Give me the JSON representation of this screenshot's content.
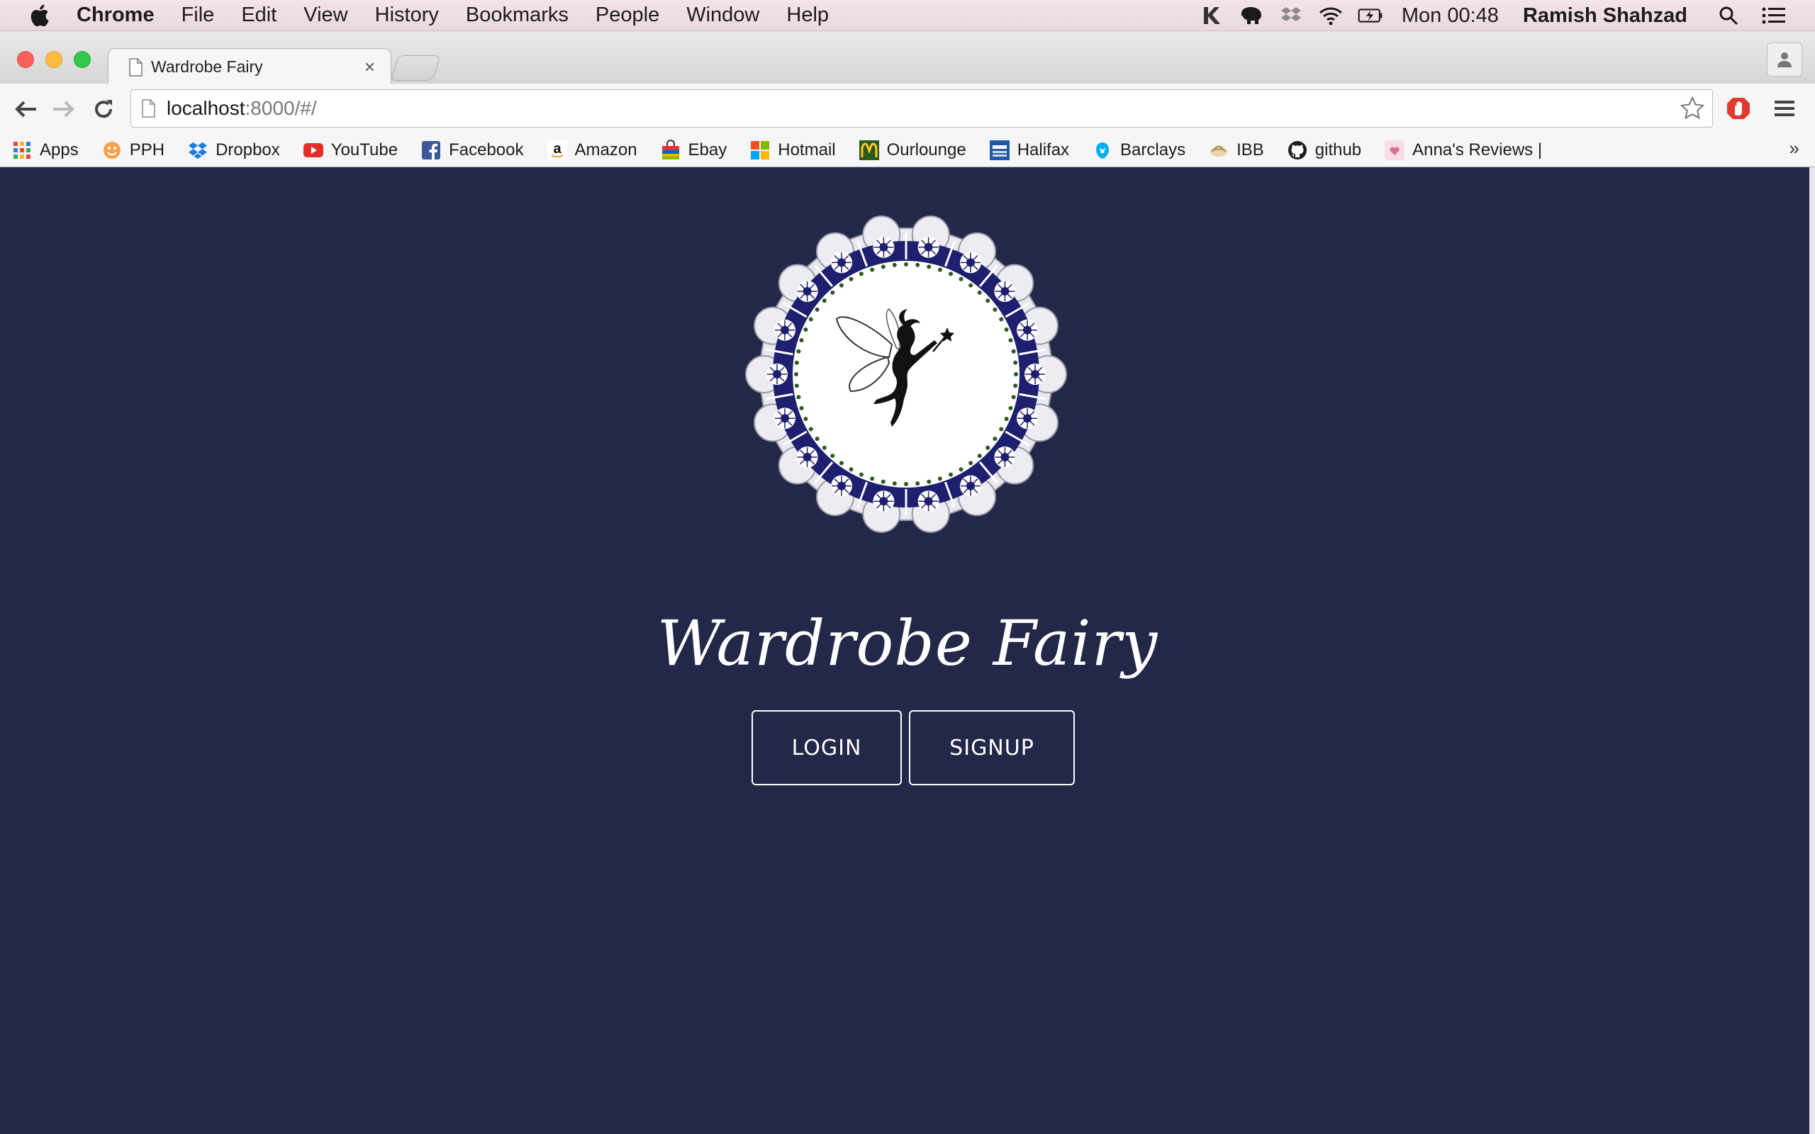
{
  "menubar": {
    "app_name": "Chrome",
    "items": [
      "File",
      "Edit",
      "View",
      "History",
      "Bookmarks",
      "People",
      "Window",
      "Help"
    ],
    "clock": "Mon 00:48",
    "user": "Ramish Shahzad"
  },
  "tab": {
    "title": "Wardrobe Fairy",
    "close_glyph": "×"
  },
  "omnibox": {
    "url_host": "localhost",
    "url_rest": ":8000/#/"
  },
  "bookmarks": {
    "items": [
      "Apps",
      "PPH",
      "Dropbox",
      "YouTube",
      "Facebook",
      "Amazon",
      "Ebay",
      "Hotmail",
      "Ourlounge",
      "Halifax",
      "Barclays",
      "IBB",
      "github",
      "Anna's Reviews |"
    ],
    "more_glyph": "»"
  },
  "page": {
    "title": "Wardrobe Fairy",
    "login_label": "LOGIN",
    "signup_label": "SIGNUP",
    "background": "#242848"
  },
  "colors": {
    "page_bg": "#242848",
    "lace_blue": "#1e1f6e",
    "dot_green": "#2e5a1f",
    "text": "#ffffff"
  },
  "icons": {
    "logo": "fairy-lace-medallion",
    "menubar_status": [
      "k-icon",
      "evernote-elephant-icon",
      "dropbox-icon",
      "wifi-icon",
      "battery-icon",
      "spotlight-search-icon",
      "notification-center-icon"
    ]
  }
}
